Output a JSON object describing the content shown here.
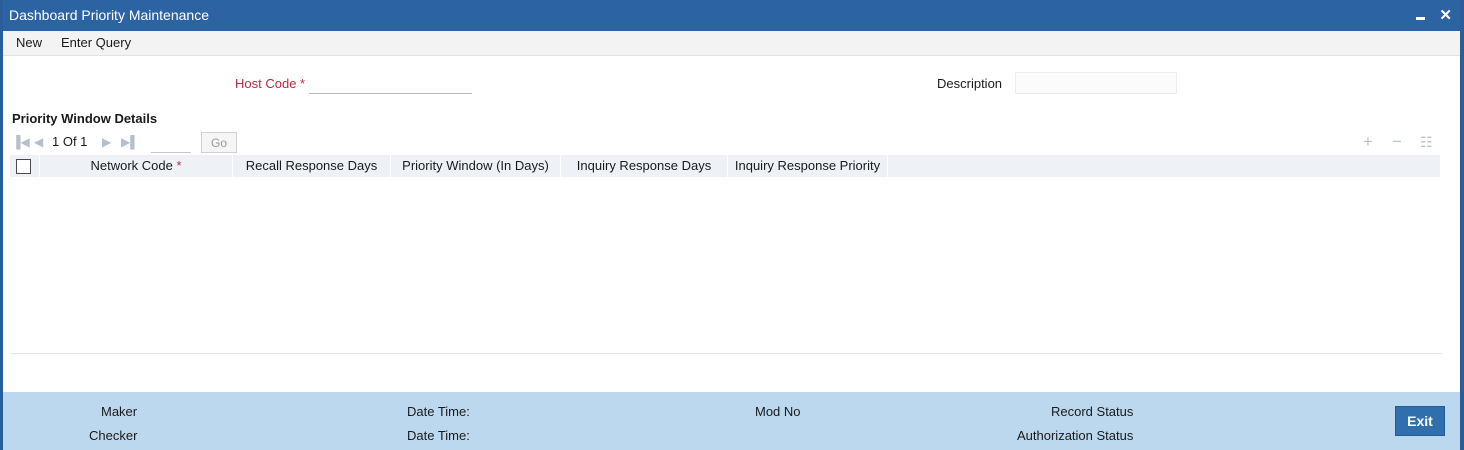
{
  "window": {
    "title": "Dashboard Priority Maintenance"
  },
  "menu": {
    "new_label": "New",
    "enter_query_label": "Enter Query"
  },
  "form": {
    "host_code_label": "Host Code",
    "required_marker": "*",
    "host_code_value": "",
    "description_label": "Description",
    "description_value": ""
  },
  "section": {
    "title": "Priority Window Details"
  },
  "pagination": {
    "text": "1 Of 1",
    "page_value": "",
    "go_label": "Go"
  },
  "table": {
    "columns": [
      "Network Code",
      "Recall Response Days",
      "Priority Window (In Days)",
      "Inquiry Response Days",
      "Inquiry Response Priority"
    ],
    "required_marker": "*",
    "rows": []
  },
  "footer": {
    "maker_label": "Maker",
    "checker_label": "Checker",
    "date_time_label_1": "Date Time:",
    "date_time_label_2": "Date Time:",
    "mod_no_label": "Mod No",
    "record_status_label": "Record Status",
    "authorization_status_label": "Authorization Status",
    "exit_label": "Exit"
  },
  "colors": {
    "titlebar": "#2c64a3",
    "footer": "#bcd8ee",
    "required": "#c0283c",
    "exit_button": "#2f6fad"
  }
}
